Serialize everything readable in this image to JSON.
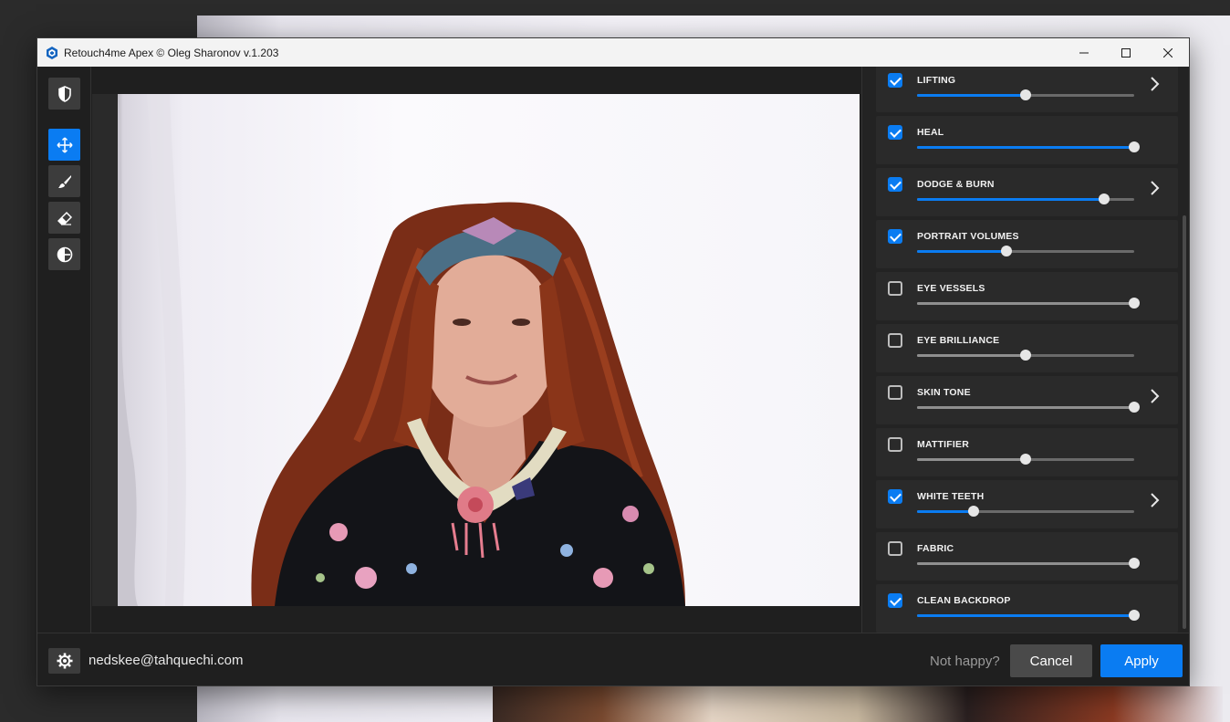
{
  "window": {
    "title": "Retouch4me Apex © Oleg Sharonov v.1.203",
    "minimize_icon": "minimize-icon",
    "maximize_icon": "maximize-icon",
    "close_icon": "close-icon"
  },
  "toolbar": {
    "tools": [
      {
        "name": "shield-icon",
        "active": false
      },
      {
        "name": "move-icon",
        "active": true
      },
      {
        "name": "brush-icon",
        "active": false
      },
      {
        "name": "eraser-icon",
        "active": false
      },
      {
        "name": "compare-icon",
        "active": false
      }
    ]
  },
  "panel": {
    "items": [
      {
        "label": "LIFTING",
        "checked": true,
        "value": 0.5,
        "has_submenu": true
      },
      {
        "label": "HEAL",
        "checked": true,
        "value": 1.0,
        "has_submenu": false
      },
      {
        "label": "DODGE & BURN",
        "checked": true,
        "value": 0.86,
        "has_submenu": true
      },
      {
        "label": "PORTRAIT VOLUMES",
        "checked": true,
        "value": 0.41,
        "has_submenu": false
      },
      {
        "label": "EYE VESSELS",
        "checked": false,
        "value": 1.0,
        "has_submenu": false
      },
      {
        "label": "EYE BRILLIANCE",
        "checked": false,
        "value": 0.5,
        "has_submenu": false
      },
      {
        "label": "SKIN TONE",
        "checked": false,
        "value": 1.0,
        "has_submenu": true
      },
      {
        "label": "MATTIFIER",
        "checked": false,
        "value": 0.5,
        "has_submenu": false
      },
      {
        "label": "WHITE TEETH",
        "checked": true,
        "value": 0.26,
        "has_submenu": true
      },
      {
        "label": "FABRIC",
        "checked": false,
        "value": 1.0,
        "has_submenu": false
      },
      {
        "label": "CLEAN BACKDROP",
        "checked": true,
        "value": 1.0,
        "has_submenu": false
      }
    ]
  },
  "footer": {
    "user_email": "nedskee@tahquechi.com",
    "not_happy_label": "Not happy?",
    "cancel_label": "Cancel",
    "apply_label": "Apply"
  },
  "colors": {
    "accent": "#0a7cf2",
    "panel_bg": "#232323",
    "item_bg": "#2a2a2a"
  }
}
